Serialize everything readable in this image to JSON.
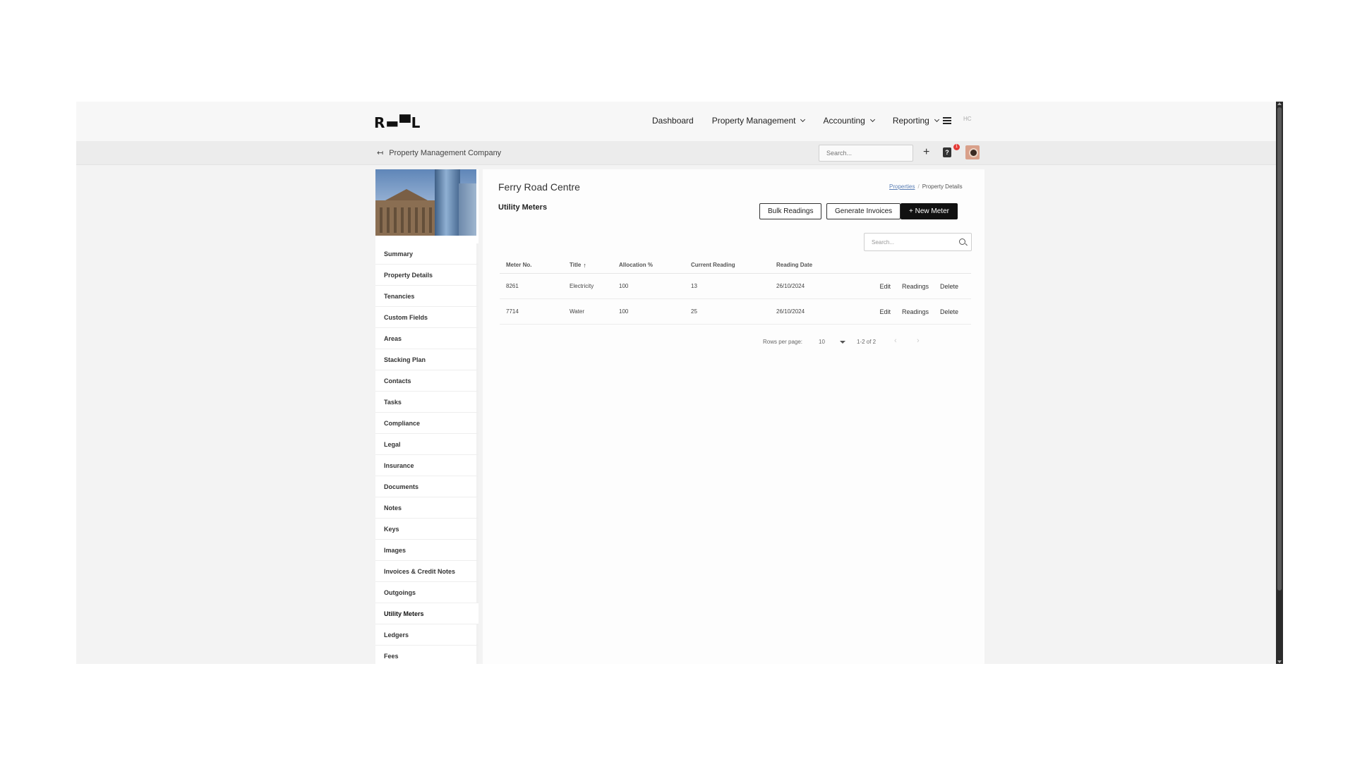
{
  "header": {
    "logo": "R▬▀L",
    "nav": [
      {
        "label": "Dashboard"
      },
      {
        "label": "Property Management"
      },
      {
        "label": "Accounting"
      },
      {
        "label": "Reporting"
      }
    ],
    "user_initials": "HC"
  },
  "subbar": {
    "back_icon": "↤",
    "company": "Property Management Company",
    "search_placeholder": "Search...",
    "plus": "+",
    "help": "?",
    "notification_count": "1"
  },
  "sidebar": {
    "items": [
      "Summary",
      "Property Details",
      "Tenancies",
      "Custom Fields",
      "Areas",
      "Stacking Plan",
      "Contacts",
      "Tasks",
      "Compliance",
      "Legal",
      "Insurance",
      "Documents",
      "Notes",
      "Keys",
      "Images",
      "Invoices & Credit Notes",
      "Outgoings",
      "Utility Meters",
      "Ledgers",
      "Fees"
    ],
    "active": "Utility Meters"
  },
  "main": {
    "property_title": "Ferry Road Centre",
    "breadcrumb": {
      "link": "Properties",
      "sep": "/",
      "current": "Property Details"
    },
    "section_title": "Utility Meters",
    "buttons": {
      "bulk": "Bulk Readings",
      "generate": "Generate Invoices",
      "new": "+  New Meter"
    },
    "search_placeholder": "Search...",
    "table": {
      "headers": [
        "Meter No.",
        "Title",
        "Allocation %",
        "Current Reading",
        "Reading Date"
      ],
      "sort_indicator": "↑",
      "rows": [
        {
          "meter": "8261",
          "title": "Electricity",
          "allocation": "100",
          "reading": "13",
          "date": "26/10/2024"
        },
        {
          "meter": "7714",
          "title": "Water",
          "allocation": "100",
          "reading": "25",
          "date": "26/10/2024"
        }
      ],
      "actions": [
        "Edit",
        "Readings",
        "Delete"
      ]
    },
    "pagination": {
      "label": "Rows per page:",
      "rows_per_page": "10",
      "range": "1-2 of 2",
      "prev": "‹",
      "next": "›"
    }
  }
}
